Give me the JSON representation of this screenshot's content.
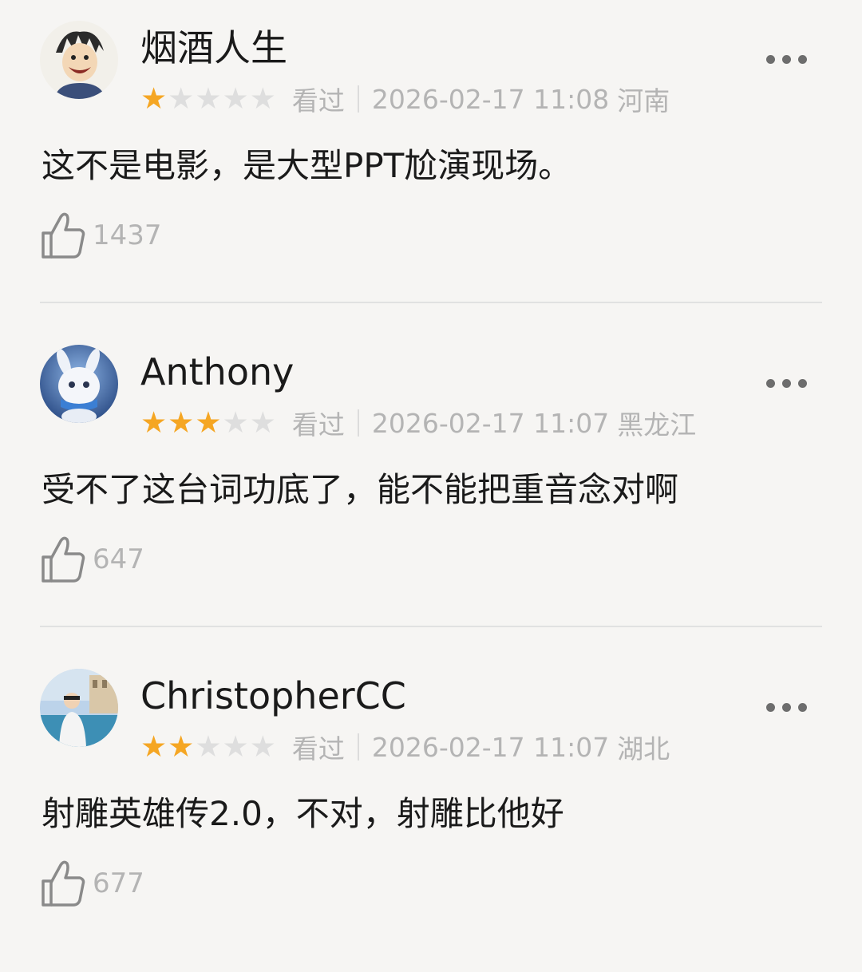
{
  "reviews": [
    {
      "username": "烟酒人生",
      "rating": 1,
      "max_rating": 5,
      "status": "看过",
      "datetime": "2026-02-17 11:08",
      "location": "河南",
      "content": "这不是电影，是大型PPT尬演现场。",
      "likes": "1437"
    },
    {
      "username": "Anthony",
      "rating": 3,
      "max_rating": 5,
      "status": "看过",
      "datetime": "2026-02-17 11:07",
      "location": "黑龙江",
      "content": "受不了这台词功底了，能不能把重音念对啊",
      "likes": "647"
    },
    {
      "username": "ChristopherCC",
      "rating": 2,
      "max_rating": 5,
      "status": "看过",
      "datetime": "2026-02-17 11:07",
      "location": "湖北",
      "content": "射雕英雄传2.0，不对，射雕比他好",
      "likes": "677"
    }
  ],
  "colors": {
    "star_on": "#f5a623",
    "star_off": "#dedede",
    "muted_text": "#b4b4b4",
    "text": "#1a1a1a"
  },
  "icons": {
    "like": "thumbs-up-icon",
    "more": "more-dots-icon",
    "star": "star-icon"
  }
}
